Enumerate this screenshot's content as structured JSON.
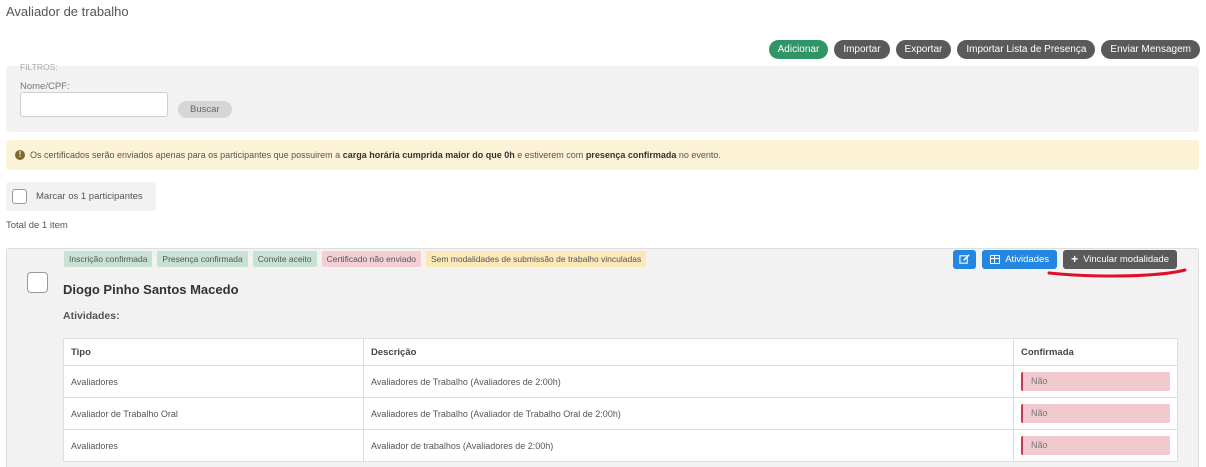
{
  "page": {
    "title": "Avaliador de trabalho"
  },
  "toolbar": {
    "buttons": [
      "Adicionar",
      "Importar",
      "Exportar",
      "Importar Lista de Presença",
      "Enviar Mensagem"
    ]
  },
  "filters": {
    "legend": "FILTROS:",
    "field_label": "Nome/CPF:",
    "field_value": "",
    "search_button": "Buscar"
  },
  "alert": {
    "text1": "Os certificados serão enviados apenas para os participantes que possuirem a",
    "bold1": "carga horária cumprida maior do que 0h",
    "text2": "e estiverem com",
    "bold2": "presença confirmada",
    "text3": "no evento."
  },
  "select_all": {
    "label": "Marcar os 1 participantes"
  },
  "total": "Total de 1 item",
  "participant": {
    "name": "Diogo Pinho Santos Macedo",
    "badges": [
      {
        "label": "Inscrição confirmada",
        "color": "#c7e2d3"
      },
      {
        "label": "Presença confirmada",
        "color": "#c7e2d3"
      },
      {
        "label": "Convite aceito",
        "color": "#c7e2d3"
      },
      {
        "label": "Certificado não enviado",
        "color": "#f3cfd3"
      },
      {
        "label": "Sem modalidades de submissão de trabalho vinculadas",
        "color": "#fbe9b8"
      }
    ],
    "actions": {
      "edit_icon": "edit-icon",
      "activities_button": "Atividades",
      "link_modality_button": "Vincular modalidade"
    },
    "activities_title": "Atividades:",
    "table": {
      "headers": [
        "Tipo",
        "Descrição",
        "Confirmada"
      ],
      "rows": [
        [
          "Avaliadores",
          "Avaliadores de Trabalho (Avaliadores de 2:00h)",
          "Não"
        ],
        [
          "Avaliador de Trabalho Oral",
          "Avaliadores de Trabalho (Avaliador de Trabalho Oral de 2:00h)",
          "Não"
        ],
        [
          "Avaliadores",
          "Avaliador de trabalhos (Avaliadores de 2:00h)",
          "Não"
        ]
      ]
    }
  },
  "colors": {
    "green_button": "#2f9466",
    "dark_button": "#5a5a5a",
    "blue_button": "#2386e0",
    "annotation_red": "#e0102a"
  }
}
